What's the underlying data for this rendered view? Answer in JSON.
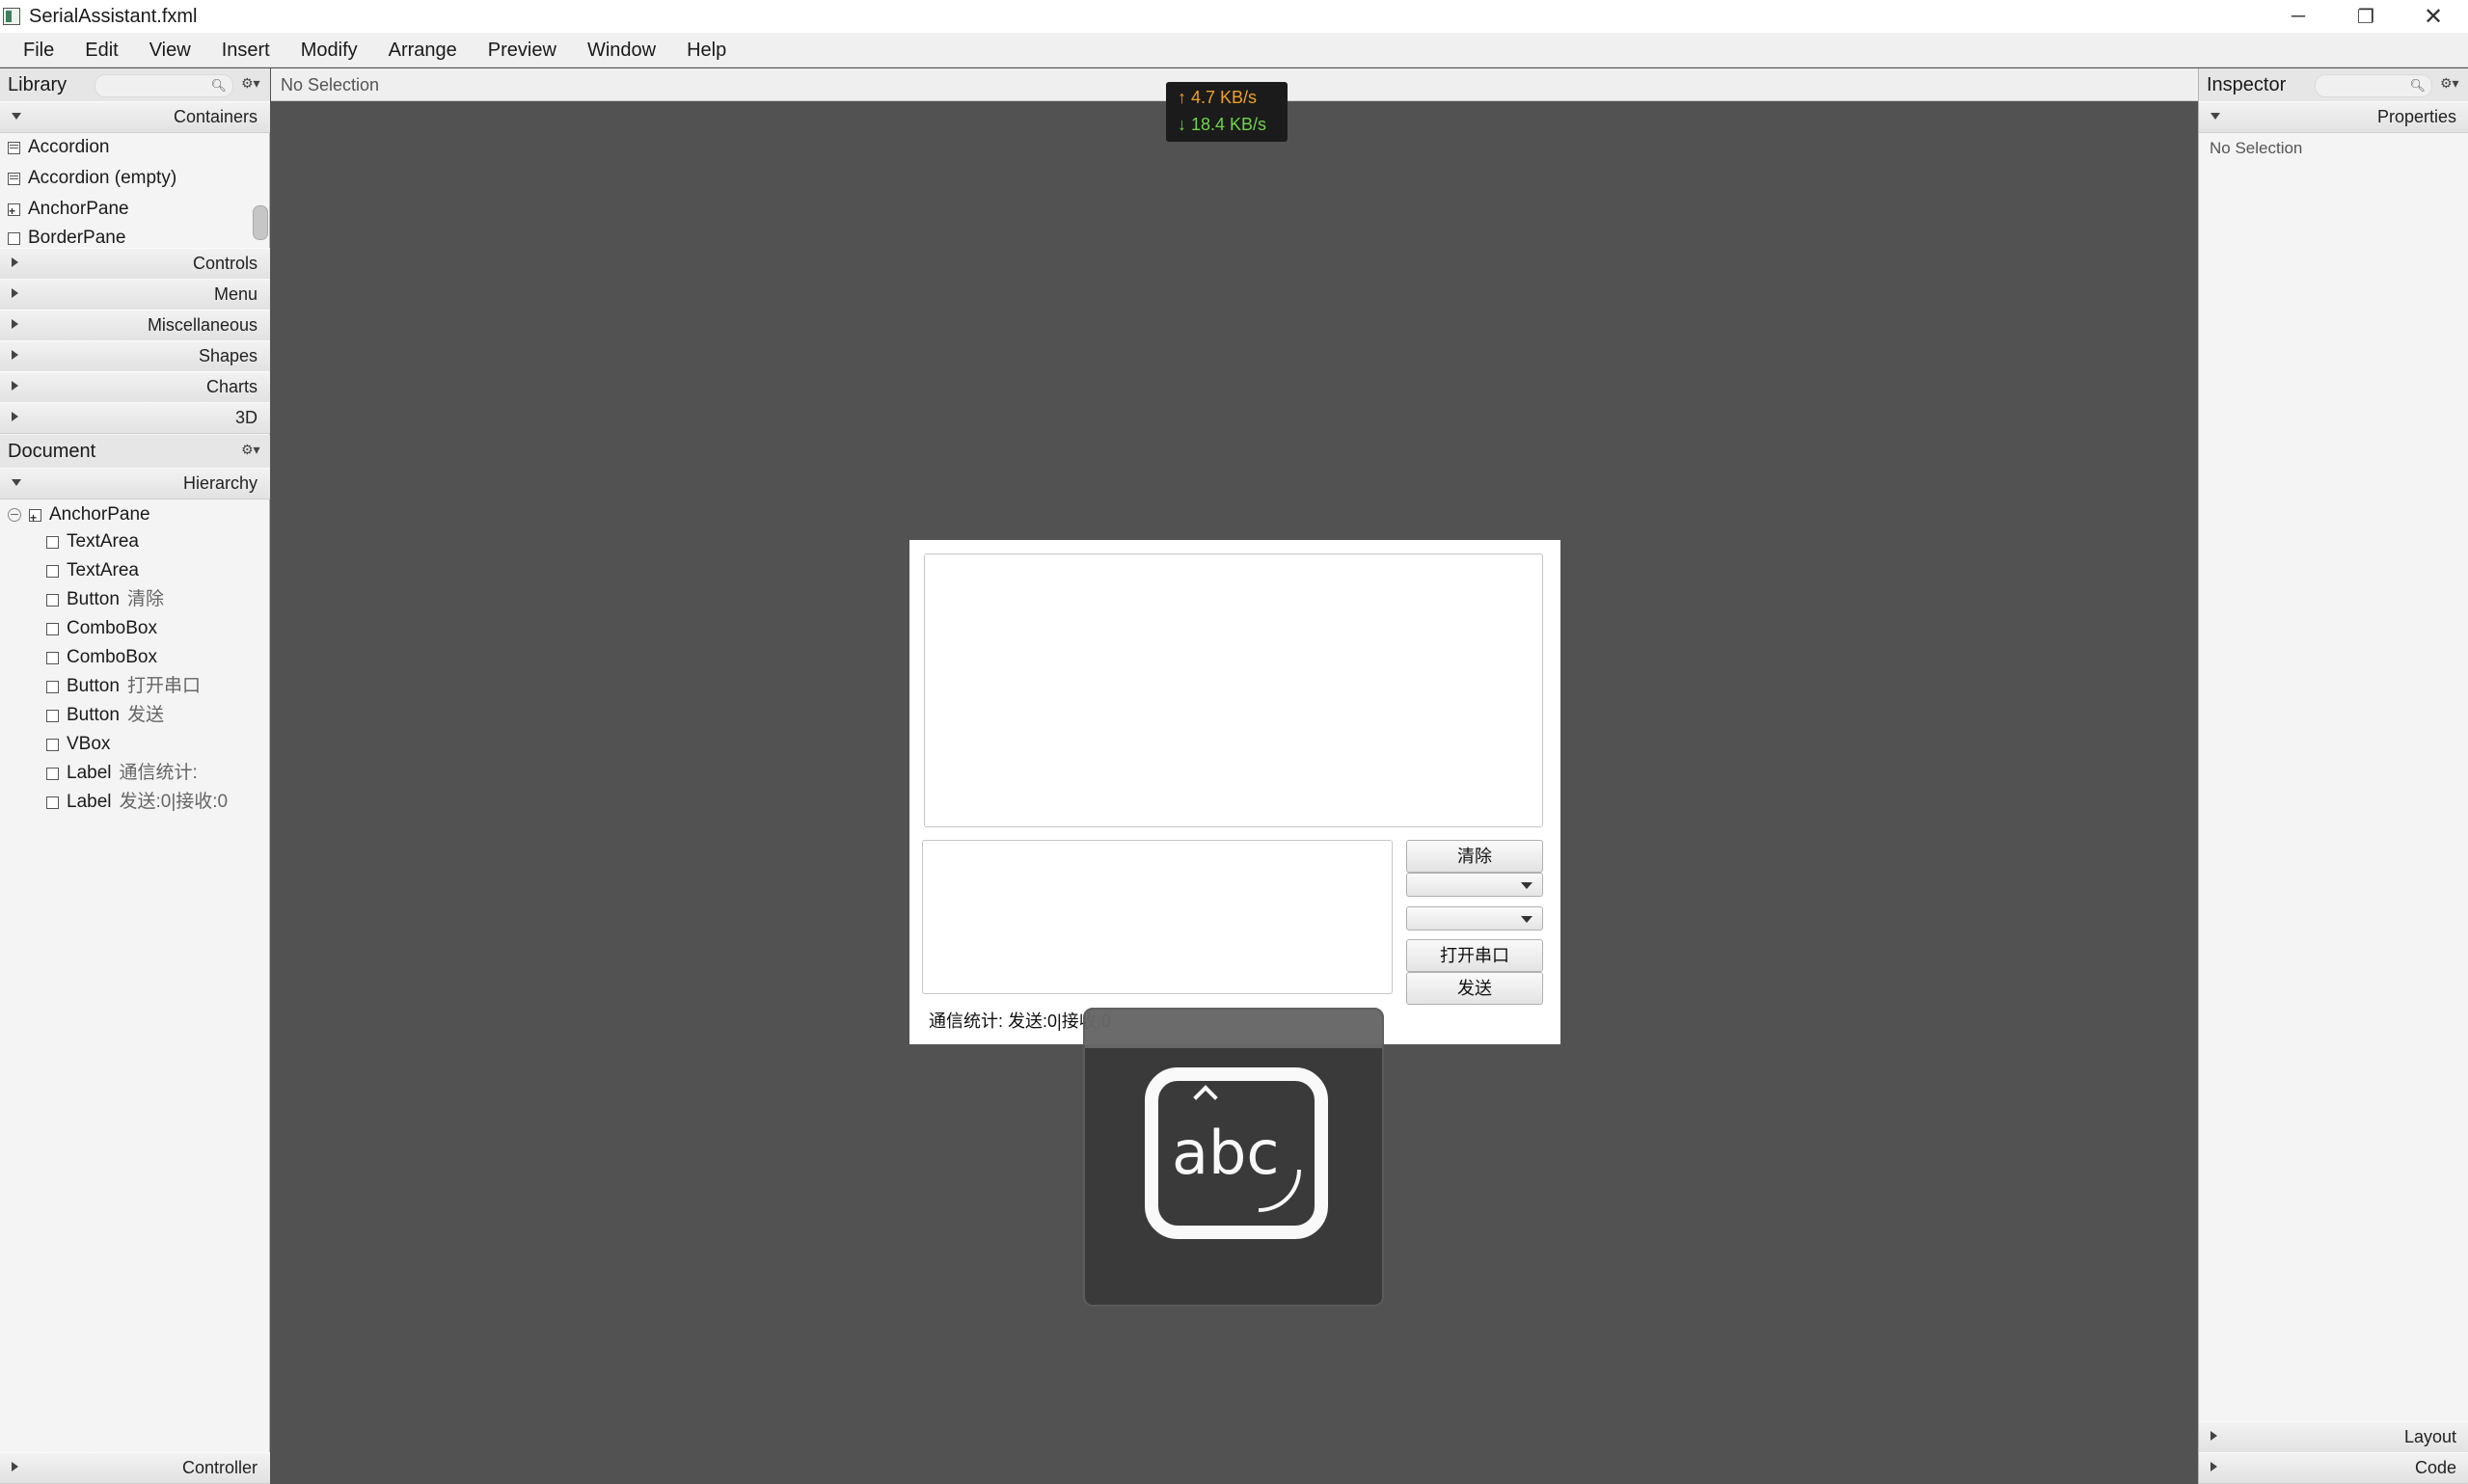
{
  "window": {
    "title": "SerialAssistant.fxml",
    "minimize": "─",
    "restore": "❐",
    "close": "✕"
  },
  "menu": [
    "File",
    "Edit",
    "View",
    "Insert",
    "Modify",
    "Arrange",
    "Preview",
    "Window",
    "Help"
  ],
  "library": {
    "title": "Library",
    "sections": {
      "containers": "Containers",
      "controls": "Controls",
      "menu": "Menu",
      "misc": "Miscellaneous",
      "shapes": "Shapes",
      "charts": "Charts",
      "three_d": "3D"
    },
    "items": [
      "Accordion",
      "Accordion  (empty)",
      "AnchorPane",
      "BorderPane"
    ]
  },
  "document": {
    "title": "Document",
    "hierarchy_label": "Hierarchy",
    "root": "AnchorPane",
    "nodes": [
      {
        "type": "TextArea",
        "text": ""
      },
      {
        "type": "TextArea",
        "text": ""
      },
      {
        "type": "Button",
        "text": "清除"
      },
      {
        "type": "ComboBox",
        "text": ""
      },
      {
        "type": "ComboBox",
        "text": ""
      },
      {
        "type": "Button",
        "text": "打开串口"
      },
      {
        "type": "Button",
        "text": "发送"
      },
      {
        "type": "VBox",
        "text": ""
      },
      {
        "type": "Label",
        "text": "通信统计:"
      },
      {
        "type": "Label",
        "text": "发送:0|接收:0"
      }
    ],
    "controller_label": "Controller"
  },
  "center": {
    "selection": "No Selection"
  },
  "net_speed": {
    "up": "↑ 4.7 KB/s",
    "down": "↓ 18.4 KB/s"
  },
  "form": {
    "btn_clear": "清除",
    "btn_open_port": "打开串口",
    "btn_send": "发送",
    "stats": "通信统计: 发送:0|接收:0"
  },
  "ime": {
    "text": "abc"
  },
  "inspector": {
    "title": "Inspector",
    "properties_label": "Properties",
    "empty_text": "No Selection",
    "layout_label": "Layout",
    "code_label": "Code"
  },
  "colors": {
    "canvas": "#525252",
    "net_up": "#f0a020",
    "net_down": "#6fd34a"
  }
}
